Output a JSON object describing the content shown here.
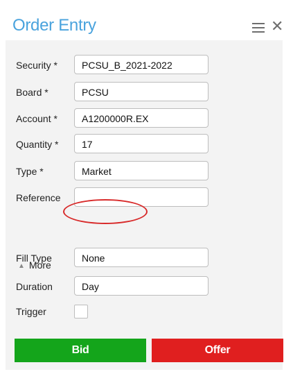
{
  "header": {
    "title": "Order Entry"
  },
  "fields": [
    {
      "label": "Security *",
      "value": "PCSU_B_2021-2022"
    },
    {
      "label": "Board *",
      "value": "PCSU"
    },
    {
      "label": "Account *",
      "value": "A1200000R.EX"
    },
    {
      "label": "Quantity *",
      "value": "17"
    },
    {
      "label": "Type *",
      "value": "Market"
    },
    {
      "label": "Reference",
      "value": ""
    }
  ],
  "more": {
    "label": "More"
  },
  "extra_fields": [
    {
      "label": "Fill Type",
      "value": "None"
    },
    {
      "label": "Duration",
      "value": "Day"
    },
    {
      "label": "Trigger",
      "checked": false
    }
  ],
  "actions": {
    "bid_label": "Bid",
    "offer_label": "Offer"
  },
  "colors": {
    "title": "#4aa3dd",
    "bid": "#14a51b",
    "offer": "#e01f1f",
    "highlight_oval": "#d82a2a"
  }
}
